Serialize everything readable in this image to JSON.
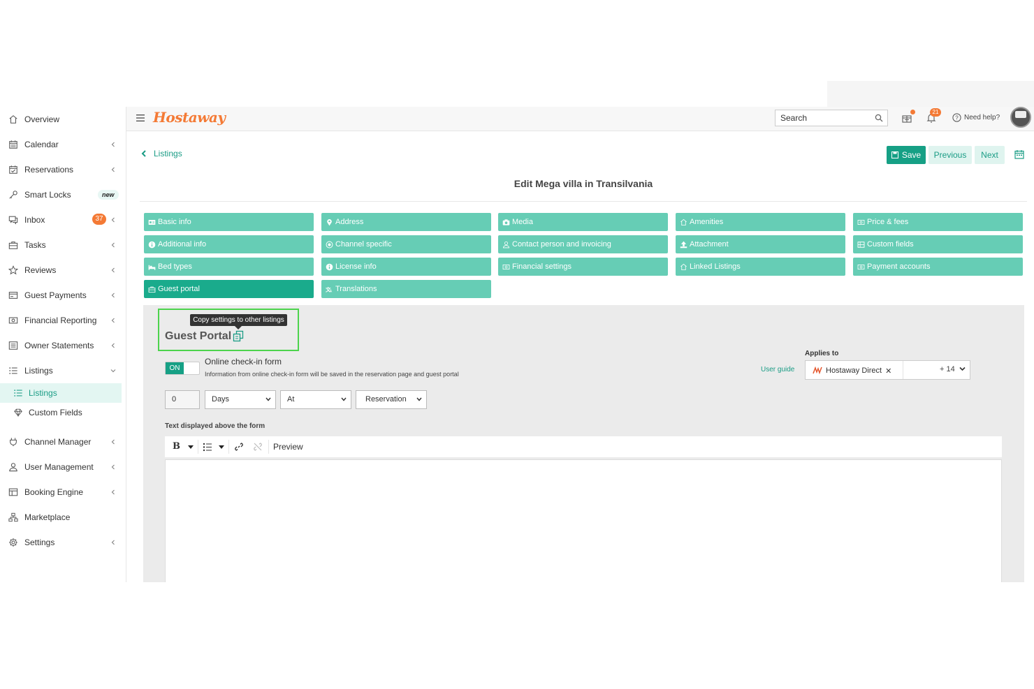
{
  "app": {
    "logo": "Hostaway",
    "brand_color": "#f47a35",
    "accent_color": "#16a085"
  },
  "sidebar": {
    "items": [
      {
        "label": "Overview",
        "icon": "home-icon",
        "chevron": false
      },
      {
        "label": "Calendar",
        "icon": "calendar-icon",
        "chevron": true
      },
      {
        "label": "Reservations",
        "icon": "calendar-check-icon",
        "chevron": true
      },
      {
        "label": "Smart Locks",
        "icon": "key-icon",
        "chevron": false,
        "badge": "new"
      },
      {
        "label": "Inbox",
        "icon": "chat-icon",
        "chevron": true,
        "count": "37"
      },
      {
        "label": "Tasks",
        "icon": "briefcase-icon",
        "chevron": true
      },
      {
        "label": "Reviews",
        "icon": "star-icon",
        "chevron": true
      },
      {
        "label": "Guest Payments",
        "icon": "credit-card-icon",
        "chevron": true
      },
      {
        "label": "Financial Reporting",
        "icon": "money-icon",
        "chevron": true
      },
      {
        "label": "Owner Statements",
        "icon": "list-box-icon",
        "chevron": true
      },
      {
        "label": "Listings",
        "icon": "list-icon",
        "chevron": true,
        "expanded": true
      },
      {
        "label": "Channel Manager",
        "icon": "plug-icon",
        "chevron": true
      },
      {
        "label": "User Management",
        "icon": "user-icon",
        "chevron": true
      },
      {
        "label": "Booking Engine",
        "icon": "layout-icon",
        "chevron": true
      },
      {
        "label": "Marketplace",
        "icon": "network-icon",
        "chevron": false
      },
      {
        "label": "Settings",
        "icon": "gear-icon",
        "chevron": true
      }
    ],
    "subitems": [
      {
        "label": "Listings",
        "icon": "list-icon",
        "active": true
      },
      {
        "label": "Custom Fields",
        "icon": "diamond-icon",
        "active": false
      }
    ]
  },
  "header": {
    "search_placeholder": "Search",
    "notification_count": "21",
    "need_help": "Need help?"
  },
  "toolbar": {
    "back_label": "Listings",
    "save_label": "Save",
    "previous_label": "Previous",
    "next_label": "Next"
  },
  "page_title": "Edit Mega villa in Transilvania",
  "tabs": [
    {
      "label": "Basic info",
      "icon": "id-card-icon"
    },
    {
      "label": "Address",
      "icon": "map-pin-icon"
    },
    {
      "label": "Media",
      "icon": "camera-icon"
    },
    {
      "label": "Amenities",
      "icon": "home-icon"
    },
    {
      "label": "Price & fees",
      "icon": "money-icon"
    },
    {
      "label": "Additional info",
      "icon": "info-icon"
    },
    {
      "label": "Channel specific",
      "icon": "target-icon"
    },
    {
      "label": "Contact person and invoicing",
      "icon": "user-icon"
    },
    {
      "label": "Attachment",
      "icon": "upload-icon"
    },
    {
      "label": "Custom fields",
      "icon": "grid-icon"
    },
    {
      "label": "Bed types",
      "icon": "bed-icon"
    },
    {
      "label": "License info",
      "icon": "info-icon"
    },
    {
      "label": "Financial settings",
      "icon": "money-icon"
    },
    {
      "label": "Linked Listings",
      "icon": "home-icon"
    },
    {
      "label": "Payment accounts",
      "icon": "money-icon"
    },
    {
      "label": "Guest portal",
      "icon": "briefcase-icon",
      "active": true
    },
    {
      "label": "Translations",
      "icon": "translate-icon"
    }
  ],
  "guest_portal": {
    "tooltip": "Copy settings to other listings",
    "title": "Guest Portal",
    "toggle_label": "ON",
    "checkin_label": "Online check-in form",
    "checkin_description": "Information from online check-in form will be saved in the reservation page and guest portal",
    "applies_to_label": "Applies to",
    "user_guide": "User guide",
    "applies_chip": "Hostaway Direct",
    "applies_more": "+ 14",
    "offset_value": "0",
    "unit_select": "Days",
    "relation_select": "At",
    "event_select": "Reservation",
    "text_above_label": "Text displayed above the form",
    "editor_bold": "B",
    "editor_preview": "Preview"
  }
}
